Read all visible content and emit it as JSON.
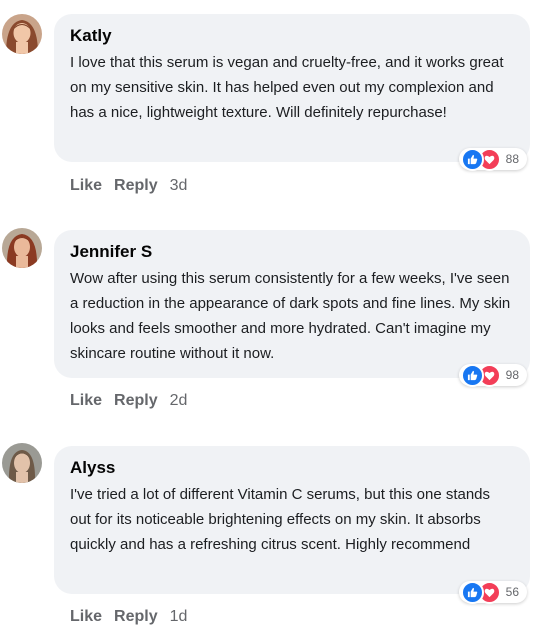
{
  "comments": [
    {
      "author": "Katly",
      "text": "I love that this serum is vegan and cruelty-free, and it works great on my sensitive skin. It has helped even out my complexion and has a nice, lightweight texture. Will definitely repurchase!",
      "reaction_count": "88",
      "like_label": "Like",
      "reply_label": "Reply",
      "time": "3d"
    },
    {
      "author": "Jennifer S",
      "text": "Wow after using this serum consistently for a few weeks, I've seen a reduction in the appearance of dark spots and fine lines. My skin looks and feels smoother and more hydrated. Can't imagine my skincare routine without it now.",
      "reaction_count": "98",
      "like_label": "Like",
      "reply_label": "Reply",
      "time": "2d"
    },
    {
      "author": "Alyss",
      "text": "I've tried a lot of different Vitamin C serums, but this one stands out for its noticeable brightening effects on my skin. It absorbs quickly and has a refreshing citrus scent. Highly recommend",
      "reaction_count": "56",
      "like_label": "Like",
      "reply_label": "Reply",
      "time": "1d"
    }
  ],
  "icons": {
    "like": "thumbs-up-icon",
    "love": "heart-icon"
  },
  "colors": {
    "bubble": "#f0f2f5",
    "like": "#1877f2",
    "love": "#f33e58",
    "secondary_text": "#65676b"
  }
}
